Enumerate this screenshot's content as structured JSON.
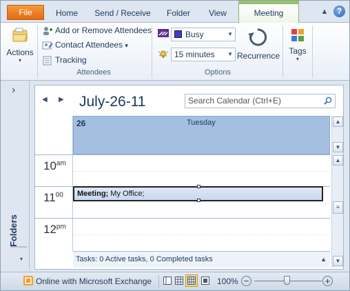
{
  "tabs": {
    "file": "File",
    "home": "Home",
    "send_receive": "Send / Receive",
    "folder": "Folder",
    "view": "View",
    "meeting": "Meeting"
  },
  "window": {
    "minimize_glyph": "▲",
    "help_glyph": "?"
  },
  "ribbon": {
    "actions_label": "Actions",
    "attendees": {
      "add_remove": "Add or Remove Attendees",
      "contact": "Contact Attendees",
      "contact_arrow": "▾",
      "tracking": "Tracking",
      "group_label": "Attendees"
    },
    "options": {
      "show_as_value": "Busy",
      "reminder_value": "15 minutes",
      "recurrence_label": "Recurrence",
      "group_label": "Options"
    },
    "tags_label": "Tags"
  },
  "nav": {
    "expand_glyph": "›",
    "folders_label": "Folders",
    "collapse_glyph": "▾"
  },
  "calendar": {
    "prev_glyph": "◀",
    "next_glyph": "▶",
    "date_title": "July-26-11",
    "search_placeholder": "Search Calendar (Ctrl+E)",
    "day_number": "26",
    "day_name": "Tuesday",
    "hours": [
      {
        "hour": "10",
        "suffix": "am"
      },
      {
        "hour": "11",
        "suffix": "00"
      },
      {
        "hour": "12",
        "suffix": "pm"
      }
    ],
    "appointment": {
      "bold_text": "Meeting;",
      "text": " My Office;"
    },
    "tasks_text": "Tasks: 0 Active tasks, 0 Completed tasks",
    "tasks_toggle": "▲"
  },
  "status": {
    "connection": "Online with Microsoft Exchange",
    "zoom": "100%",
    "zoom_minus": "−",
    "zoom_plus": "+"
  },
  "colors": {
    "accent_file": "#e36a10",
    "meeting_tab": "#9bc46f",
    "day_header": "#a5bfe1"
  }
}
